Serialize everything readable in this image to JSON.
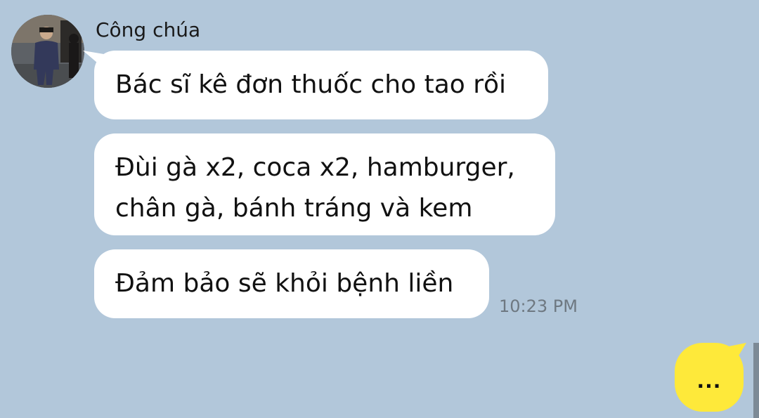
{
  "contact": {
    "name": "Công chúa",
    "avatar_icon": "person-photo-avatar"
  },
  "messages": [
    {
      "text": "Bác sĩ kê đơn thuốc cho tao rồi"
    },
    {
      "text": "Đùi gà x2, coca x2, hamburger,\nchân gà, bánh tráng và kem"
    },
    {
      "text": "Đảm bảo sẽ khỏi bệnh liền"
    }
  ],
  "timestamp": "10:23 PM",
  "outgoing": {
    "text": "..."
  },
  "colors": {
    "background": "#b2c7da",
    "incoming_bubble": "#ffffff",
    "outgoing_bubble": "#fee93a"
  }
}
